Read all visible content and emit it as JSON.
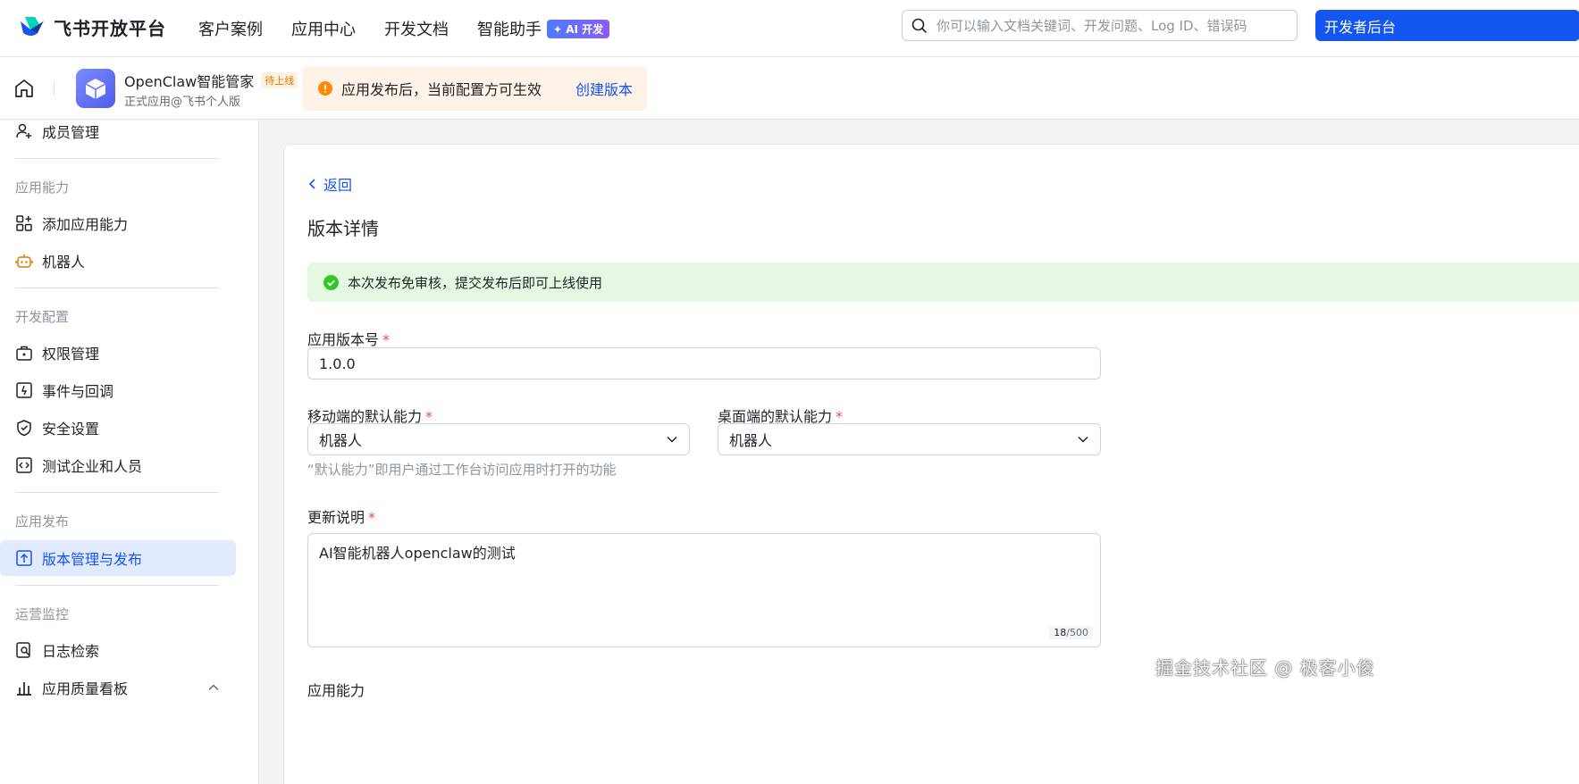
{
  "topnav": {
    "logo_text": "飞书开放平台",
    "items": [
      {
        "label": "客户案例"
      },
      {
        "label": "应用中心"
      },
      {
        "label": "开发文档"
      },
      {
        "label": "智能助手"
      }
    ],
    "ai_badge": "✦ AI 开发",
    "search_placeholder": "你可以输入文档关键词、开发问题、Log ID、错误码",
    "dev_button": "开发者后台"
  },
  "appbar": {
    "app_name": "OpenClaw智能管家",
    "status_tag": "待上线",
    "app_subtitle": "正式应用@飞书个人版",
    "notice_text": "应用发布后，当前配置方可生效",
    "notice_link": "创建版本"
  },
  "sidebar": {
    "member_mgmt": "成员管理",
    "group_ability": "应用能力",
    "add_ability": "添加应用能力",
    "robot": "机器人",
    "group_dev": "开发配置",
    "permission": "权限管理",
    "events": "事件与回调",
    "security": "安全设置",
    "test_org": "测试企业和人员",
    "group_publish": "应用发布",
    "version_mgmt": "版本管理与发布",
    "group_ops": "运营监控",
    "log_search": "日志检索",
    "quality": "应用质量看板"
  },
  "main": {
    "back": "返回",
    "title": "版本详情",
    "success_text": "本次发布免审核，提交发布后即可上线使用",
    "version_label": "应用版本号",
    "version_value": "1.0.0",
    "mobile_label": "移动端的默认能力",
    "mobile_value": "机器人",
    "desktop_label": "桌面端的默认能力",
    "desktop_value": "机器人",
    "hint": "“默认能力”即用户通过工作台访问应用时打开的功能",
    "notes_label": "更新说明",
    "notes_value": "AI智能机器人openclaw的测试",
    "notes_count": "18",
    "notes_max": "/500",
    "ability_label": "应用能力",
    "required_mark": "*"
  },
  "watermark": "掘金技术社区 @ 极客小俊",
  "colors": {
    "accent": "#1456f0",
    "success_bg": "#e4f8e2",
    "warning_bg": "#fef3e6",
    "required": "#f54a45"
  }
}
